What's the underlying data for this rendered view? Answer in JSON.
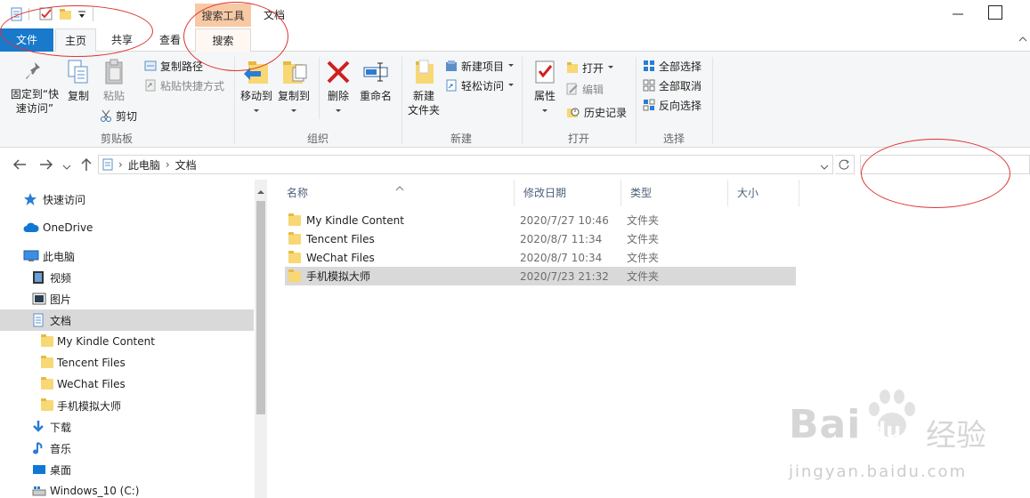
{
  "window": {
    "title": "文档",
    "context_tab_header": "搜索工具"
  },
  "tabs": {
    "file": "文件",
    "home": "主页",
    "share": "共享",
    "view": "查看",
    "search": "搜索"
  },
  "ribbon": {
    "clipboard": {
      "label": "剪贴板",
      "pin": "固定到“快",
      "pin2": "速访问”",
      "copy": "复制",
      "paste": "粘贴",
      "copy_path": "复制路径",
      "paste_shortcut": "粘贴快捷方式",
      "cut": "剪切"
    },
    "organize": {
      "label": "组织",
      "move_to": "移动到",
      "copy_to": "复制到",
      "delete": "删除",
      "rename": "重命名"
    },
    "new": {
      "label": "新建",
      "new_folder": "新建",
      "new_folder2": "文件夹",
      "new_item": "新建项目",
      "easy_access": "轻松访问"
    },
    "open": {
      "label": "打开",
      "properties": "属性",
      "open": "打开",
      "edit": "编辑",
      "history": "历史记录"
    },
    "select": {
      "label": "选择",
      "select_all": "全部选择",
      "select_none": "全部取消",
      "invert": "反向选择"
    }
  },
  "address": {
    "crumbs": [
      "此电脑",
      "文档"
    ],
    "search_placeholder": ""
  },
  "nav": {
    "items": [
      {
        "label": "快速访问",
        "icon": "star-icon"
      },
      {
        "label": "OneDrive",
        "icon": "cloud-icon"
      },
      {
        "label": "此电脑",
        "icon": "pc-icon"
      },
      {
        "label": "视频",
        "icon": "video-icon"
      },
      {
        "label": "图片",
        "icon": "picture-icon"
      },
      {
        "label": "文档",
        "icon": "document-icon"
      },
      {
        "label": "My Kindle Content",
        "icon": "folder-icon"
      },
      {
        "label": "Tencent Files",
        "icon": "folder-icon"
      },
      {
        "label": "WeChat Files",
        "icon": "folder-icon"
      },
      {
        "label": "手机模拟大师",
        "icon": "folder-icon"
      },
      {
        "label": "下载",
        "icon": "download-icon"
      },
      {
        "label": "音乐",
        "icon": "music-icon"
      },
      {
        "label": "桌面",
        "icon": "desktop-icon"
      },
      {
        "label": "Windows_10 (C:)",
        "icon": "drive-icon"
      }
    ]
  },
  "list": {
    "columns": [
      "名称",
      "修改日期",
      "类型",
      "大小"
    ],
    "rows": [
      {
        "name": "My Kindle Content",
        "date": "2020/7/27 10:46",
        "type": "文件夹"
      },
      {
        "name": "Tencent Files",
        "date": "2020/8/7 11:34",
        "type": "文件夹"
      },
      {
        "name": "WeChat Files",
        "date": "2020/8/7 10:34",
        "type": "文件夹"
      },
      {
        "name": "手机模拟大师",
        "date": "2020/7/23 21:32",
        "type": "文件夹"
      }
    ]
  },
  "watermark": {
    "brand": "Bai",
    "brand2": "du",
    "cn": "经验",
    "url": "jingyan.baidu.com"
  },
  "colors": {
    "file_tab": "#1979ca",
    "context_tab": "#f8c9a5",
    "selected_row": "#d9d9d9",
    "annotation": "#dd3333"
  }
}
